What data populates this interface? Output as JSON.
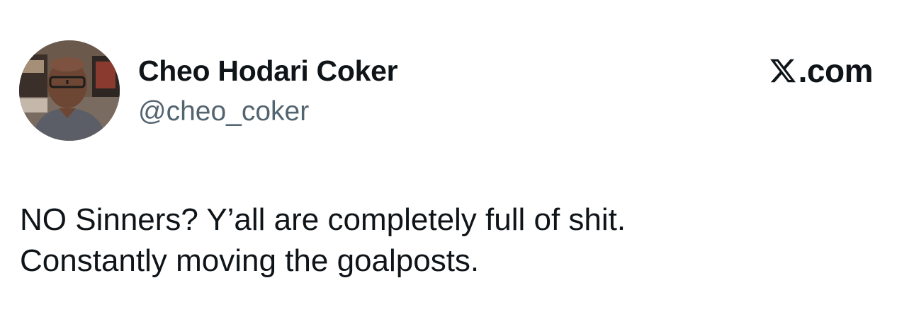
{
  "tweet": {
    "author": {
      "display_name": "Cheo Hodari Coker",
      "handle": "@cheo_coker",
      "avatar_icon": "profile-photo"
    },
    "brand": {
      "logo_icon": "x-logo-icon",
      "text": ".com"
    },
    "text_lines": [
      "NO Sinners? Y’all are completely full of shit.",
      "Constantly moving the goalposts."
    ]
  },
  "colors": {
    "background": "#ffffff",
    "primary_text": "#0f1419",
    "secondary_text": "#536471"
  }
}
